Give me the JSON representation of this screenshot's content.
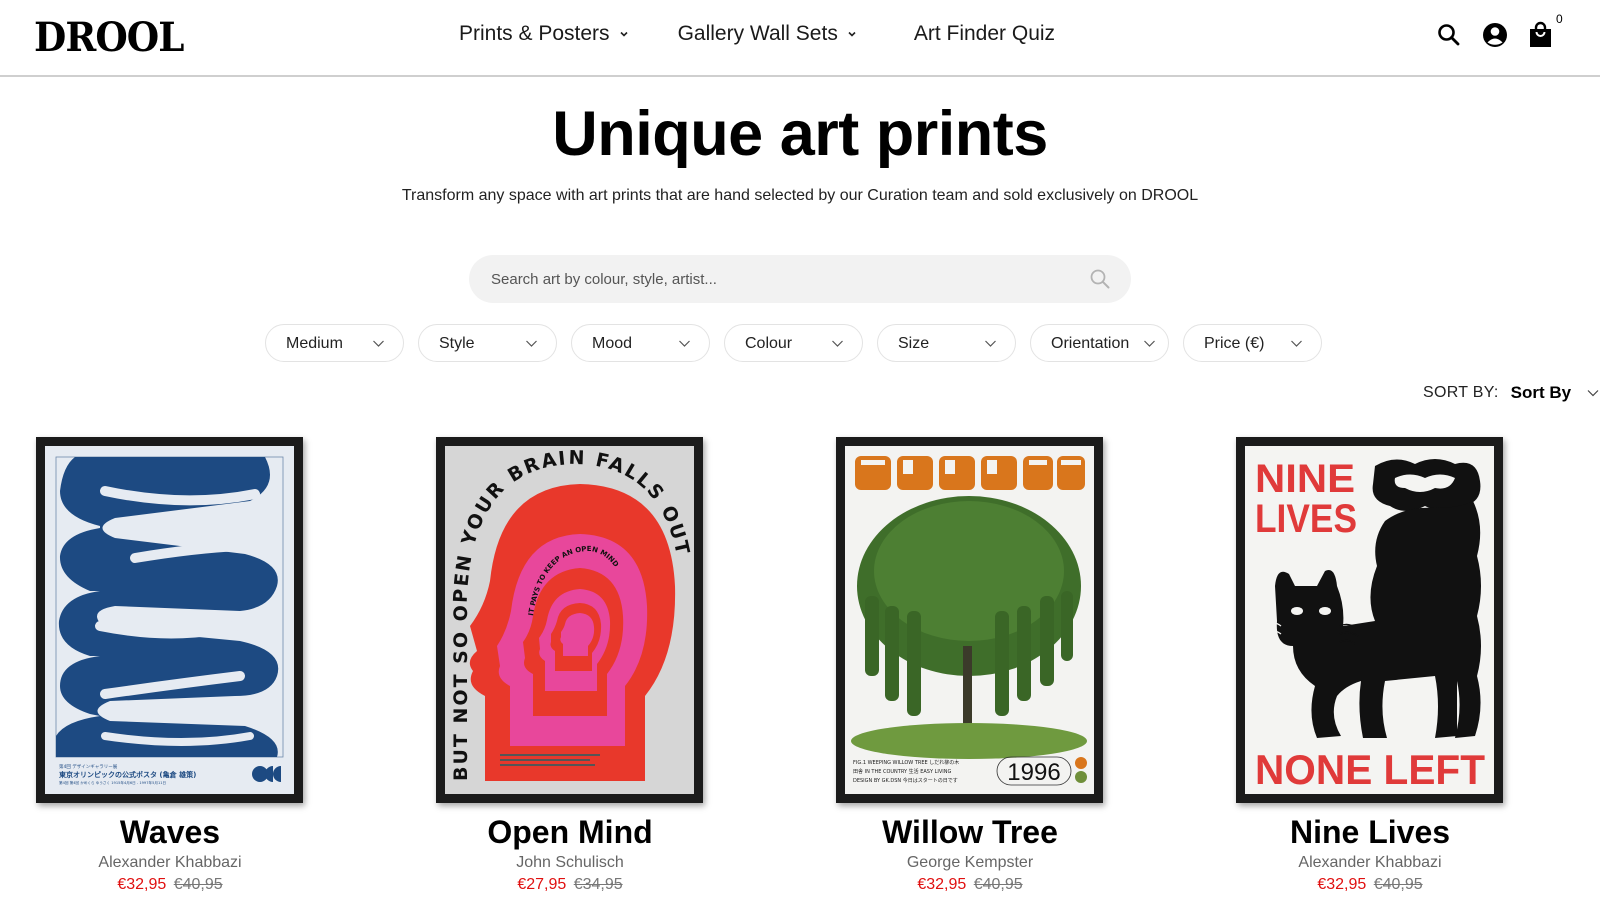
{
  "header": {
    "logo": "DROOL",
    "nav": [
      {
        "label": "Prints & Posters",
        "has_dropdown": true
      },
      {
        "label": "Gallery Wall Sets",
        "has_dropdown": true
      },
      {
        "label": "Art Finder Quiz",
        "has_dropdown": false
      }
    ],
    "icons": [
      "search-icon",
      "account-icon",
      "cart-icon"
    ],
    "cart_count": "0"
  },
  "hero": {
    "title": "Unique art prints",
    "subtitle": "Transform any space with art prints that are hand selected by our Curation team and sold exclusively on DROOL"
  },
  "search": {
    "placeholder": "Search art by colour, style, artist...",
    "value": ""
  },
  "filters": [
    {
      "label": "Medium"
    },
    {
      "label": "Style"
    },
    {
      "label": "Mood"
    },
    {
      "label": "Colour"
    },
    {
      "label": "Size"
    },
    {
      "label": "Orientation"
    },
    {
      "label": "Price (€)"
    }
  ],
  "sort": {
    "label": "SORT BY:",
    "value": "Sort By"
  },
  "products": [
    {
      "title": "Waves",
      "artist": "Alexander Khabbazi",
      "sale_price": "€32,95",
      "original_price": "€40,95",
      "art": {
        "caption_jp": "東京オリンピックの公式ポスタ (亀倉 雄策)"
      }
    },
    {
      "title": "Open Mind",
      "artist": "John Schulisch",
      "sale_price": "€27,95",
      "original_price": "€34,95",
      "art": {
        "outer_text": "BUT NOT SO OPEN YOUR BRAIN FALLS OUT",
        "inner_text": "IT PAYS TO KEEP AN OPEN MIND"
      }
    },
    {
      "title": "Willow Tree",
      "artist": "George Kempster",
      "sale_price": "€32,95",
      "original_price": "€40,95",
      "art": {
        "line1": "FIG.1 WEEPING WILLOW TREE しだれ柳の木",
        "line2": "田舎 IN THE COUNTRY 生活 EASY LIVING",
        "line3": "DESIGN BY GK.DSN 今日はスタートの日です",
        "year": "1996"
      }
    },
    {
      "title": "Nine Lives",
      "artist": "Alexander Khabbazi",
      "sale_price": "€32,95",
      "original_price": "€40,95",
      "art": {
        "top_text_1": "NINE",
        "top_text_2": "LIVES",
        "bottom_text": "NONE LEFT"
      }
    }
  ],
  "colors": {
    "sale_price": "#e01010",
    "original_price": "#777777",
    "search_bg": "#f2f2f2",
    "frame": "#1b1b1b"
  }
}
